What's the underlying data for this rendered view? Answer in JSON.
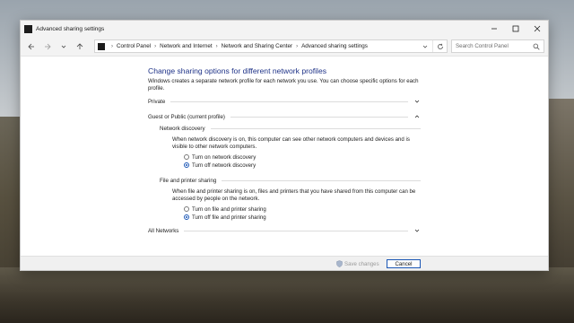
{
  "window": {
    "title": "Advanced sharing settings",
    "controls": {
      "minimize": "—",
      "maximize": "▢",
      "close": "✕"
    }
  },
  "address_bar": {
    "breadcrumbs": [
      "Control Panel",
      "Network and Internet",
      "Network and Sharing Center",
      "Advanced sharing settings"
    ],
    "search_placeholder": "Search Control Panel"
  },
  "main": {
    "title": "Change sharing options for different network profiles",
    "intro": "Windows creates a separate network profile for each network you use. You can choose specific options for each profile.",
    "profiles": {
      "private": "Private",
      "guest_public": "Guest or Public (current profile)",
      "all_networks": "All Networks"
    },
    "network_discovery": {
      "heading": "Network discovery",
      "description": "When network discovery is on, this computer can see other network computers and devices and is visible to other network computers.",
      "option_on": "Turn on network discovery",
      "option_off": "Turn off network discovery",
      "selected": "off"
    },
    "file_printer_sharing": {
      "heading": "File and printer sharing",
      "description": "When file and printer sharing is on, files and printers that you have shared from this computer can be accessed by people on the network.",
      "option_on": "Turn on file and printer sharing",
      "option_off": "Turn off file and printer sharing",
      "selected": "off"
    }
  },
  "footer": {
    "save_label": "Save changes",
    "cancel_label": "Cancel"
  },
  "colors": {
    "title_blue": "#1e3287",
    "accent": "#1a56b5"
  }
}
